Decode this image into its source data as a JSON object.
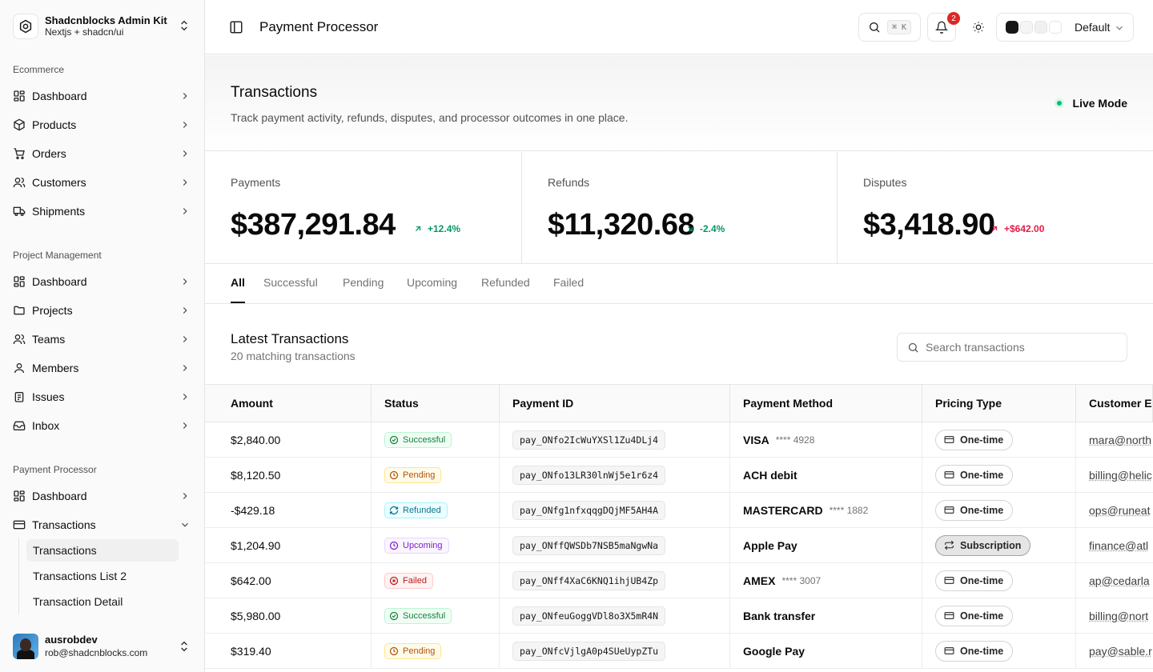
{
  "sidebar": {
    "brand_title": "Shadcnblocks Admin Kit",
    "brand_subtitle": "Nextjs + shadcn/ui",
    "groups": [
      {
        "label": "Ecommerce",
        "items": [
          "Dashboard",
          "Products",
          "Orders",
          "Customers",
          "Shipments"
        ]
      },
      {
        "label": "Project Management",
        "items": [
          "Dashboard",
          "Projects",
          "Teams",
          "Members",
          "Issues",
          "Inbox"
        ]
      },
      {
        "label": "Payment Processor",
        "items": [
          "Dashboard",
          "Transactions"
        ]
      }
    ],
    "transactions_sub": [
      "Transactions",
      "Transactions List 2",
      "Transaction Detail"
    ],
    "user": {
      "name": "ausrobdev",
      "email": "rob@shadcnblocks.com"
    }
  },
  "topbar": {
    "title": "Payment Processor",
    "shortcut": "⌘ K",
    "notification_count": "2",
    "theme_label": "Default",
    "swatches": [
      "#171717",
      "#f5f5f5",
      "#f0f0f0",
      "#ffffff"
    ]
  },
  "header": {
    "title": "Transactions",
    "description": "Track payment activity, refunds, disputes, and processor outcomes in one place.",
    "live_label": "Live Mode"
  },
  "stats": [
    {
      "label": "Payments",
      "value": "$387,291.84",
      "delta": "+12.4%",
      "direction": "up",
      "color": "#059669"
    },
    {
      "label": "Refunds",
      "value": "$11,320.68",
      "delta": "-2.4%",
      "direction": "down",
      "color": "#059669"
    },
    {
      "label": "Disputes",
      "value": "$3,418.90",
      "delta": "+$642.00",
      "direction": "up",
      "color": "#e11d48"
    }
  ],
  "tabs": [
    "All",
    "Successful",
    "Pending",
    "Upcoming",
    "Refunded",
    "Failed"
  ],
  "table": {
    "title": "Latest Transactions",
    "subtitle": "20 matching transactions",
    "search_placeholder": "Search transactions",
    "columns": [
      "Amount",
      "Status",
      "Payment ID",
      "Payment Method",
      "Pricing Type",
      "Customer Em"
    ],
    "rows": [
      {
        "amount": "$2,840.00",
        "status": "Successful",
        "status_kind": "success",
        "payment_id": "pay_ONfo2IcWuYXSl1Zu4DLj4",
        "method": "VISA",
        "last4": "**** 4928",
        "pricing": "One-time",
        "pricing_kind": "onetime",
        "email": "mara@north"
      },
      {
        "amount": "$8,120.50",
        "status": "Pending",
        "status_kind": "pending",
        "payment_id": "pay_ONfo13LR30lnWj5e1r6z4",
        "method": "ACH debit",
        "last4": "",
        "pricing": "One-time",
        "pricing_kind": "onetime",
        "email": "billing@helic"
      },
      {
        "amount": "-$429.18",
        "status": "Refunded",
        "status_kind": "refunded",
        "payment_id": "pay_ONfg1nfxqqgDQjMF5AH4A",
        "method": "MASTERCARD",
        "last4": "**** 1882",
        "pricing": "One-time",
        "pricing_kind": "onetime",
        "email": "ops@runeat"
      },
      {
        "amount": "$1,204.90",
        "status": "Upcoming",
        "status_kind": "upcoming",
        "payment_id": "pay_ONffQWSDb7NSB5maNgwNa",
        "method": "Apple Pay",
        "last4": "",
        "pricing": "Subscription",
        "pricing_kind": "subscription",
        "email": "finance@atl"
      },
      {
        "amount": "$642.00",
        "status": "Failed",
        "status_kind": "failed",
        "payment_id": "pay_ONff4XaC6KNQ1ihjUB4Zp",
        "method": "AMEX",
        "last4": "**** 3007",
        "pricing": "One-time",
        "pricing_kind": "onetime",
        "email": "ap@cedarla"
      },
      {
        "amount": "$5,980.00",
        "status": "Successful",
        "status_kind": "success",
        "payment_id": "pay_ONfeuGoggVDl8o3X5mR4N",
        "method": "Bank transfer",
        "last4": "",
        "pricing": "One-time",
        "pricing_kind": "onetime",
        "email": "billing@nort"
      },
      {
        "amount": "$319.40",
        "status": "Pending",
        "status_kind": "pending",
        "payment_id": "pay_ONfcVjlgA0p4SUeUypZTu",
        "method": "Google Pay",
        "last4": "",
        "pricing": "One-time",
        "pricing_kind": "onetime",
        "email": "pay@sable.r"
      }
    ]
  }
}
